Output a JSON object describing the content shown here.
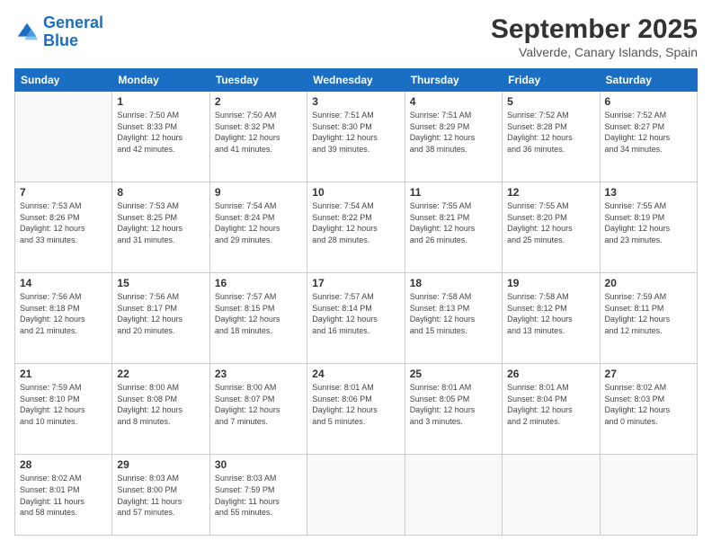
{
  "logo": {
    "line1": "General",
    "line2": "Blue"
  },
  "header": {
    "month": "September 2025",
    "location": "Valverde, Canary Islands, Spain"
  },
  "weekdays": [
    "Sunday",
    "Monday",
    "Tuesday",
    "Wednesday",
    "Thursday",
    "Friday",
    "Saturday"
  ],
  "weeks": [
    [
      {
        "day": "",
        "info": ""
      },
      {
        "day": "1",
        "info": "Sunrise: 7:50 AM\nSunset: 8:33 PM\nDaylight: 12 hours\nand 42 minutes."
      },
      {
        "day": "2",
        "info": "Sunrise: 7:50 AM\nSunset: 8:32 PM\nDaylight: 12 hours\nand 41 minutes."
      },
      {
        "day": "3",
        "info": "Sunrise: 7:51 AM\nSunset: 8:30 PM\nDaylight: 12 hours\nand 39 minutes."
      },
      {
        "day": "4",
        "info": "Sunrise: 7:51 AM\nSunset: 8:29 PM\nDaylight: 12 hours\nand 38 minutes."
      },
      {
        "day": "5",
        "info": "Sunrise: 7:52 AM\nSunset: 8:28 PM\nDaylight: 12 hours\nand 36 minutes."
      },
      {
        "day": "6",
        "info": "Sunrise: 7:52 AM\nSunset: 8:27 PM\nDaylight: 12 hours\nand 34 minutes."
      }
    ],
    [
      {
        "day": "7",
        "info": "Sunrise: 7:53 AM\nSunset: 8:26 PM\nDaylight: 12 hours\nand 33 minutes."
      },
      {
        "day": "8",
        "info": "Sunrise: 7:53 AM\nSunset: 8:25 PM\nDaylight: 12 hours\nand 31 minutes."
      },
      {
        "day": "9",
        "info": "Sunrise: 7:54 AM\nSunset: 8:24 PM\nDaylight: 12 hours\nand 29 minutes."
      },
      {
        "day": "10",
        "info": "Sunrise: 7:54 AM\nSunset: 8:22 PM\nDaylight: 12 hours\nand 28 minutes."
      },
      {
        "day": "11",
        "info": "Sunrise: 7:55 AM\nSunset: 8:21 PM\nDaylight: 12 hours\nand 26 minutes."
      },
      {
        "day": "12",
        "info": "Sunrise: 7:55 AM\nSunset: 8:20 PM\nDaylight: 12 hours\nand 25 minutes."
      },
      {
        "day": "13",
        "info": "Sunrise: 7:55 AM\nSunset: 8:19 PM\nDaylight: 12 hours\nand 23 minutes."
      }
    ],
    [
      {
        "day": "14",
        "info": "Sunrise: 7:56 AM\nSunset: 8:18 PM\nDaylight: 12 hours\nand 21 minutes."
      },
      {
        "day": "15",
        "info": "Sunrise: 7:56 AM\nSunset: 8:17 PM\nDaylight: 12 hours\nand 20 minutes."
      },
      {
        "day": "16",
        "info": "Sunrise: 7:57 AM\nSunset: 8:15 PM\nDaylight: 12 hours\nand 18 minutes."
      },
      {
        "day": "17",
        "info": "Sunrise: 7:57 AM\nSunset: 8:14 PM\nDaylight: 12 hours\nand 16 minutes."
      },
      {
        "day": "18",
        "info": "Sunrise: 7:58 AM\nSunset: 8:13 PM\nDaylight: 12 hours\nand 15 minutes."
      },
      {
        "day": "19",
        "info": "Sunrise: 7:58 AM\nSunset: 8:12 PM\nDaylight: 12 hours\nand 13 minutes."
      },
      {
        "day": "20",
        "info": "Sunrise: 7:59 AM\nSunset: 8:11 PM\nDaylight: 12 hours\nand 12 minutes."
      }
    ],
    [
      {
        "day": "21",
        "info": "Sunrise: 7:59 AM\nSunset: 8:10 PM\nDaylight: 12 hours\nand 10 minutes."
      },
      {
        "day": "22",
        "info": "Sunrise: 8:00 AM\nSunset: 8:08 PM\nDaylight: 12 hours\nand 8 minutes."
      },
      {
        "day": "23",
        "info": "Sunrise: 8:00 AM\nSunset: 8:07 PM\nDaylight: 12 hours\nand 7 minutes."
      },
      {
        "day": "24",
        "info": "Sunrise: 8:01 AM\nSunset: 8:06 PM\nDaylight: 12 hours\nand 5 minutes."
      },
      {
        "day": "25",
        "info": "Sunrise: 8:01 AM\nSunset: 8:05 PM\nDaylight: 12 hours\nand 3 minutes."
      },
      {
        "day": "26",
        "info": "Sunrise: 8:01 AM\nSunset: 8:04 PM\nDaylight: 12 hours\nand 2 minutes."
      },
      {
        "day": "27",
        "info": "Sunrise: 8:02 AM\nSunset: 8:03 PM\nDaylight: 12 hours\nand 0 minutes."
      }
    ],
    [
      {
        "day": "28",
        "info": "Sunrise: 8:02 AM\nSunset: 8:01 PM\nDaylight: 11 hours\nand 58 minutes."
      },
      {
        "day": "29",
        "info": "Sunrise: 8:03 AM\nSunset: 8:00 PM\nDaylight: 11 hours\nand 57 minutes."
      },
      {
        "day": "30",
        "info": "Sunrise: 8:03 AM\nSunset: 7:59 PM\nDaylight: 11 hours\nand 55 minutes."
      },
      {
        "day": "",
        "info": ""
      },
      {
        "day": "",
        "info": ""
      },
      {
        "day": "",
        "info": ""
      },
      {
        "day": "",
        "info": ""
      }
    ]
  ]
}
